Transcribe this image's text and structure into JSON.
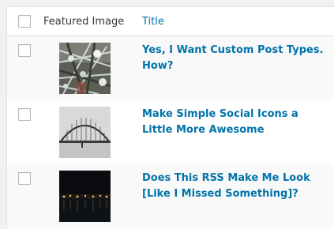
{
  "table": {
    "columns": {
      "featured_image": "Featured Image",
      "title": "Title"
    },
    "rows": [
      {
        "title": "Yes, I Want Custom Post Types. How?",
        "image": "snowy-pine-branches-photo"
      },
      {
        "title": "Make Simple Social Icons a Little More Awesome",
        "image": "bridge-arch-photo"
      },
      {
        "title": "Does This RSS Make Me Look [Like I Missed Something]?",
        "image": "night-river-lights-photo"
      }
    ]
  },
  "colors": {
    "link": "#0073aa",
    "header_text": "#32373c",
    "border": "#e1e1e1",
    "row_alt": "#f9f9f9"
  }
}
